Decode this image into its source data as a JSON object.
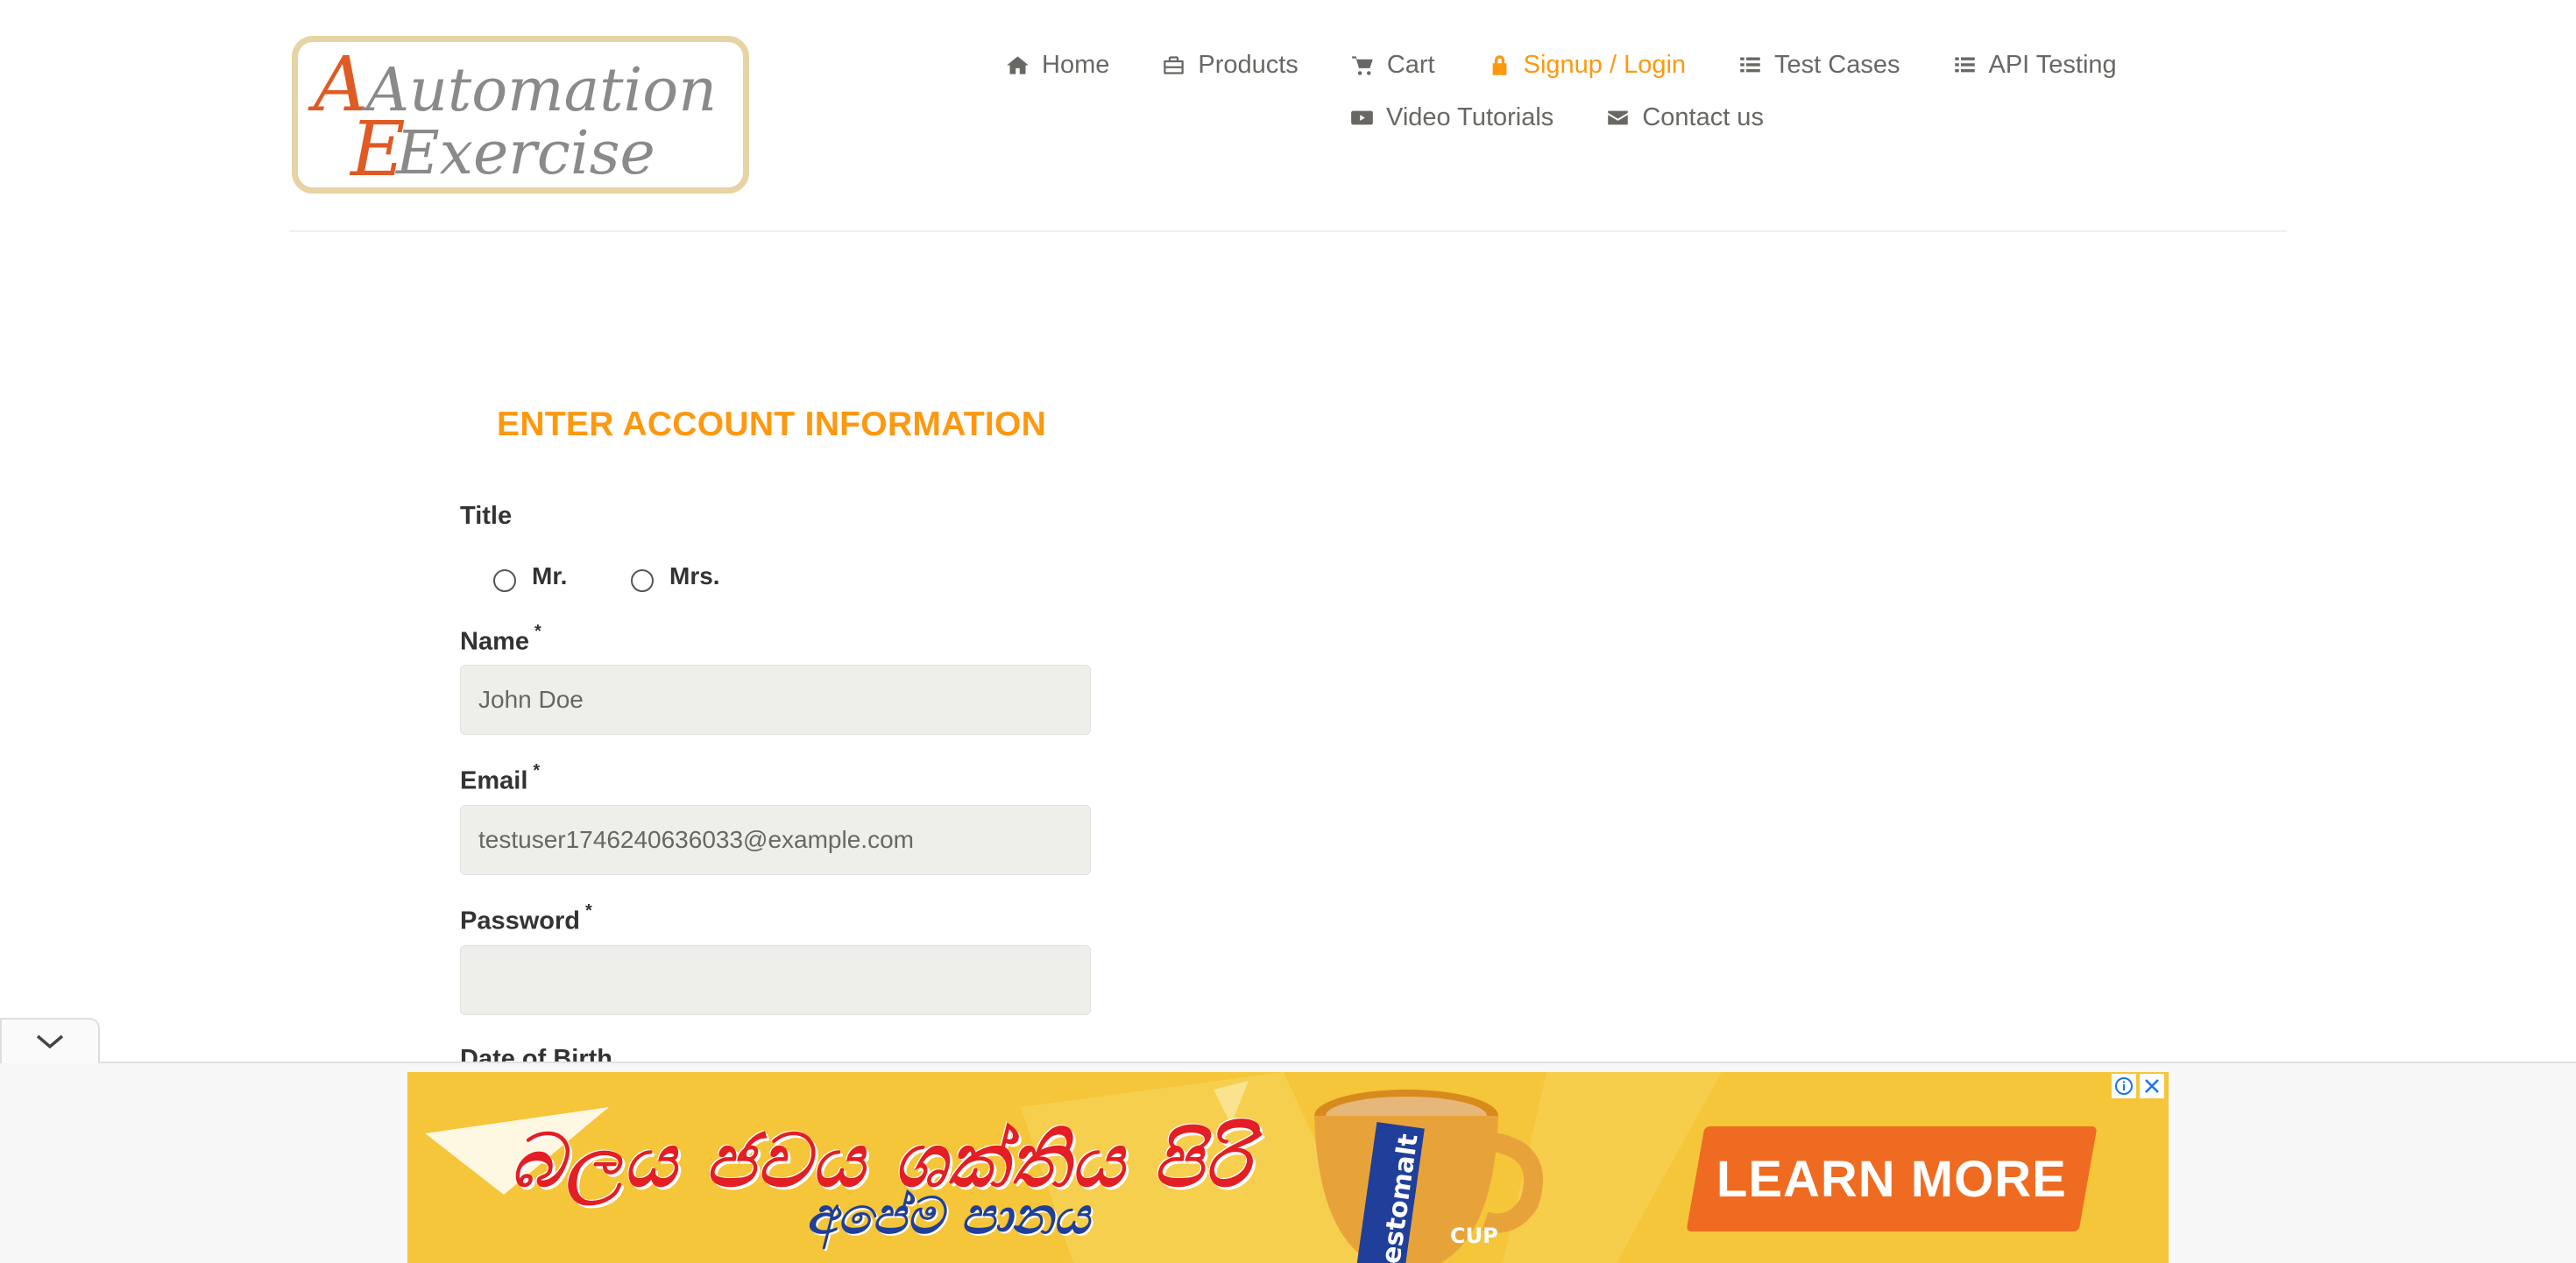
{
  "logo": {
    "line1": "Automation",
    "line2": "Exercise"
  },
  "nav": {
    "row1": [
      {
        "label": "Home",
        "icon": "home-icon"
      },
      {
        "label": "Products",
        "icon": "briefcase-icon"
      },
      {
        "label": "Cart",
        "icon": "cart-icon"
      },
      {
        "label": "Signup / Login",
        "icon": "lock-icon",
        "active": true
      },
      {
        "label": "Test Cases",
        "icon": "list-icon"
      },
      {
        "label": "API Testing",
        "icon": "list-icon"
      }
    ],
    "row2": [
      {
        "label": "Video Tutorials",
        "icon": "youtube-icon"
      },
      {
        "label": "Contact us",
        "icon": "envelope-icon"
      }
    ]
  },
  "form": {
    "title": "ENTER ACCOUNT INFORMATION",
    "title_label": "Title",
    "radio_mr": "Mr.",
    "radio_mrs": "Mrs.",
    "name_label": "Name",
    "name_value": "John Doe",
    "email_label": "Email",
    "email_value": "testuser1746240636033@example.com",
    "password_label": "Password",
    "password_value": "",
    "dob_label": "Date of Birth",
    "required_marker": "*"
  },
  "ad": {
    "headline": "බලය ජවය ශක්තිය පිරි",
    "subline": "අපේම පානය",
    "cta": "LEARN MORE",
    "brand": "estomalt",
    "cup_text": "CUP"
  },
  "colors": {
    "accent": "#fe980f",
    "nav_text": "#696763",
    "field_bg": "#eeeeea",
    "ad_bg": "#f5c53a",
    "ad_cta": "#ee6b21",
    "ad_headline": "#e31e24",
    "ad_sub": "#1f3f9a"
  }
}
